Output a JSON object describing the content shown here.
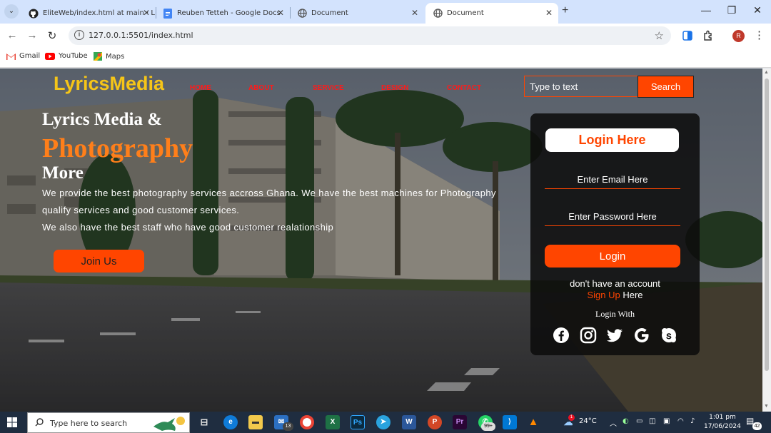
{
  "browser": {
    "tabs": [
      {
        "title": "EliteWeb/index.html at main · L",
        "icon": "github-icon"
      },
      {
        "title": "Reuben Tetteh - Google Docs",
        "icon": "google-docs-icon"
      },
      {
        "title": "Document",
        "icon": "globe-icon"
      },
      {
        "title": "Document",
        "icon": "globe-icon",
        "active": true
      }
    ],
    "url": "127.0.0.1:5501/index.html",
    "profile_initial": "R",
    "bookmarks": [
      {
        "label": "Gmail",
        "icon": "gmail-icon"
      },
      {
        "label": "YouTube",
        "icon": "youtube-icon"
      },
      {
        "label": "Maps",
        "icon": "maps-icon"
      }
    ]
  },
  "site": {
    "logo": "LyricsMedia",
    "nav": [
      "HOME",
      "ABOUT",
      "SERVICE",
      "DESIGN",
      "CONTACT"
    ],
    "search_placeholder": "Type to text",
    "search_button": "Search",
    "hero": {
      "line1": "Lyrics Media &",
      "line2": "Photography",
      "line3": "More",
      "para": [
        "We provide the best photography services accross Ghana. We have the best machines for Photography",
        "qualify services and good customer services.",
        "We also have the best staff who have good customer realationship"
      ],
      "join_button": "Join Us"
    },
    "login": {
      "title": "Login Here",
      "email_placeholder": "Enter Email Here",
      "password_placeholder": "Enter Password Here",
      "button": "Login",
      "no_account": "don't have an account",
      "signup_link": "Sign Up",
      "signup_suffix": " Here",
      "login_with": "Login With",
      "socials": [
        "facebook-icon",
        "instagram-icon",
        "twitter-icon",
        "google-icon",
        "skype-icon"
      ]
    },
    "accent_color": "#ff4500",
    "logo_color": "#f5c518"
  },
  "taskbar": {
    "search_placeholder": "Type here to search",
    "mail_badge": "13",
    "whatsapp_badge": "99+",
    "weather_alert": "1",
    "temperature": "24°C",
    "time": "1:01 pm",
    "date": "17/06/2024",
    "notifications": "42"
  }
}
